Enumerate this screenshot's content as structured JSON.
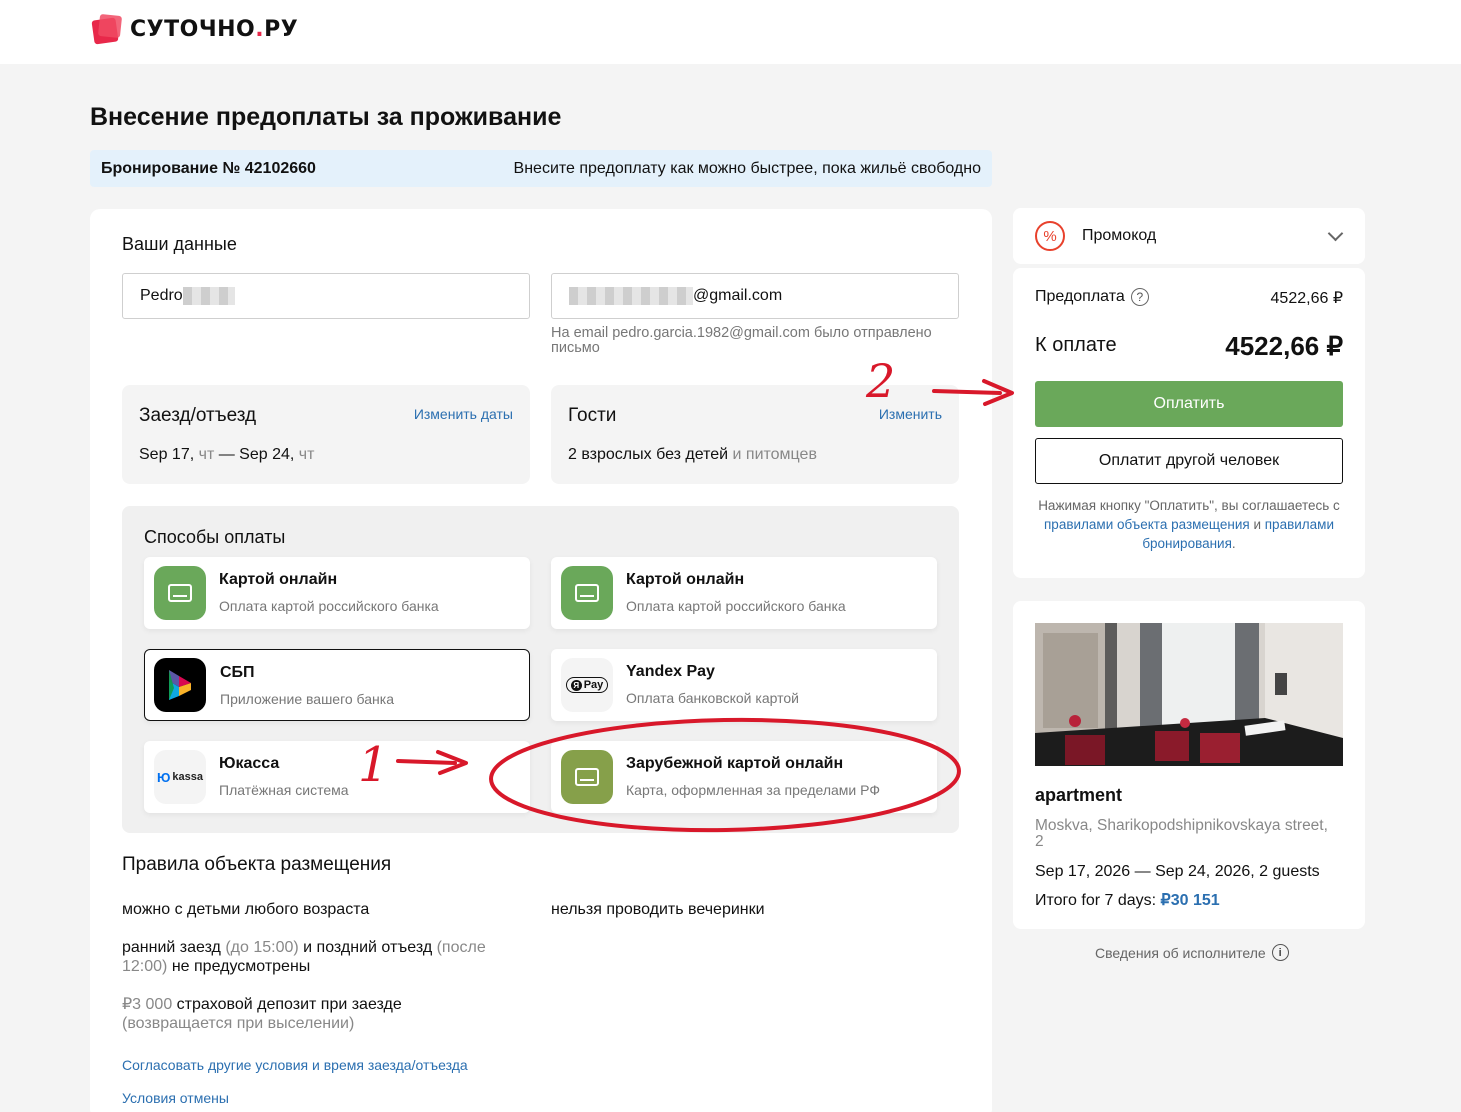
{
  "header": {
    "logo_text": "СУТОЧНО",
    "logo_dot": ".",
    "logo_suffix": "РУ"
  },
  "page_title": "Внесение предоплаты за проживание",
  "booking_bar": {
    "number": "Бронирование № 42102660",
    "message": "Внесите предоплату как можно быстрее, пока жильё свободно"
  },
  "your_data": {
    "title": "Ваши данные",
    "name_value": "Pedro",
    "email_value": "@gmail.com",
    "email_note": "На email pedro.garcia.1982@gmail.com было отправлено письмо"
  },
  "checkin": {
    "title": "Заезд/отъезд",
    "link": "Изменить даты",
    "date_from": "Sep 17,",
    "day_from": " чт",
    "dash": " — ",
    "date_to": "Sep 24,",
    "day_to": " чт"
  },
  "guests": {
    "title": "Гости",
    "link": "Изменить",
    "value": "2 взрослых без детей",
    "pets": " и питомцев"
  },
  "payment": {
    "title": "Способы оплаты",
    "methods": [
      {
        "title": "Картой онлайн",
        "subtitle": "Оплата картой российского банка",
        "icon": "card-icon"
      },
      {
        "title": "Картой онлайн",
        "subtitle": "Оплата картой российского банка",
        "icon": "card-icon"
      },
      {
        "title": "СБП",
        "subtitle": "Приложение вашего банка",
        "icon": "sbp-icon",
        "selected": true
      },
      {
        "title": "Yandex Pay",
        "subtitle": "Оплата банковской картой",
        "icon": "yandex-pay-icon",
        "badge": "Pay"
      },
      {
        "title": "Юкасса",
        "subtitle": "Платёжная система",
        "icon": "yookassa-icon",
        "badge": "kassa"
      },
      {
        "title": "Зарубежной картой онлайн",
        "subtitle": "Карта, оформленная за пределами РФ",
        "icon": "card-icon"
      }
    ]
  },
  "rules": {
    "title": "Правила объекта размещения",
    "kids": "можно с детьми любого возраста",
    "party": "нельзя проводить вечеринки",
    "early_a": "ранний заезд ",
    "early_b": "(до 15:00)",
    "early_c": " и поздний отъезд ",
    "early_d": "(после 12:00)",
    "early_e": " не предусмотрены",
    "deposit_a": "₽3 000",
    "deposit_b": "  страховой депозит при заезде",
    "deposit_c": "(возвращается при выселении)",
    "link_agree": "Согласовать другие условия и время заезда/отъезда",
    "link_cancel": "Условия отмены"
  },
  "sidebar": {
    "promo_label": "Промокод",
    "prepay_label": "Предоплата",
    "prepay_value": "4522,66 ₽",
    "topay_label": "К оплате",
    "topay_value": "4522,66 ₽",
    "pay_button": "Оплатить",
    "other_button": "Оплатит другой человек",
    "terms_a": "Нажимая кнопку \"Оплатить\", вы соглашаетесь с ",
    "terms_link1": "правилами объекта размещения",
    "terms_b": " и ",
    "terms_link2": "правилами бронирования",
    "terms_c": ".",
    "apt_name": "apartment",
    "apt_address": "Moskva, Sharikopodshipnikovskaya street, 2",
    "apt_dates": "Sep 17, 2026 — Sep 24, 2026, 2 guests",
    "apt_total_label": "Итого for 7 days: ",
    "apt_total_value": "₽30 151",
    "exec_info": "Сведения об исполнителе"
  },
  "annotations": {
    "one": "1",
    "two": "2"
  },
  "colors": {
    "accent_green": "#6aa85a",
    "link_blue": "#2b6fb0",
    "brand_red": "#e8284a",
    "annotation_red": "#d8182a"
  }
}
